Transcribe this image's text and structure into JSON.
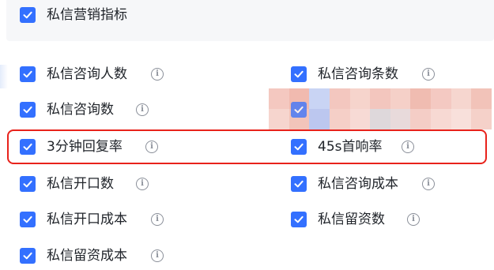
{
  "colors": {
    "checkbox_fill": "#3370ff",
    "highlight_border": "#e8221b",
    "info_icon": "#8a8f99",
    "header_background": "#f6f7f9"
  },
  "header": {
    "label": "私信营销指标",
    "checked": true
  },
  "metrics": [
    {
      "label": "私信咨询人数",
      "checked": true
    },
    {
      "label": "私信咨询条数",
      "checked": true
    },
    {
      "label": "私信咨询数",
      "checked": true
    },
    {
      "label": "",
      "checked": true,
      "redacted": true
    },
    {
      "label": "3分钟回复率",
      "checked": true
    },
    {
      "label": "45s首响率",
      "checked": true
    },
    {
      "label": "私信开口数",
      "checked": true
    },
    {
      "label": "私信咨询成本",
      "checked": true
    },
    {
      "label": "私信开口成本",
      "checked": true
    },
    {
      "label": "私信留资数",
      "checked": true
    },
    {
      "label": "私信留资成本",
      "checked": true
    }
  ],
  "info_icon_glyph": "i"
}
